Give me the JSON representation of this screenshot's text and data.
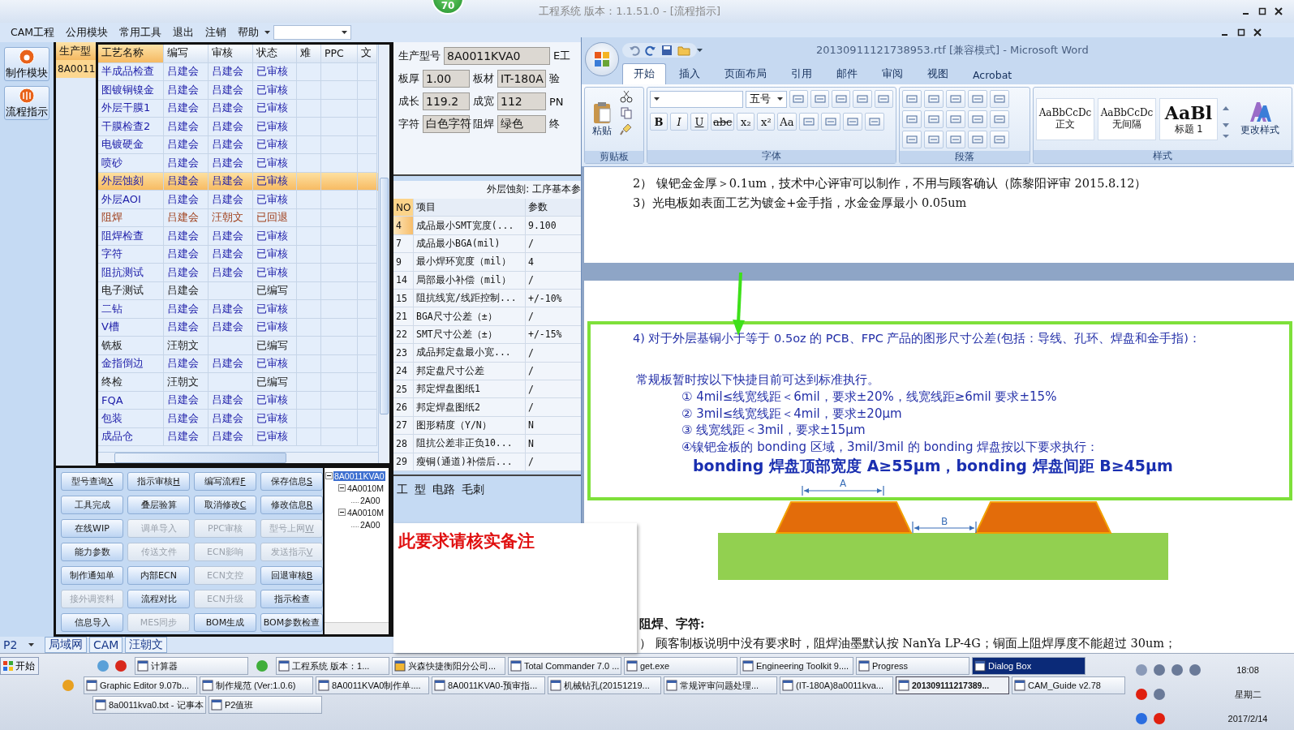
{
  "app": {
    "title": "工程系统  版本：1.1.51.0 - [流程指示]",
    "badge": "70",
    "menu": [
      "CAM工程",
      "公用模块",
      "常用工具",
      "退出",
      "注销",
      "帮助"
    ],
    "side_buttons": [
      {
        "label": "制作模块"
      },
      {
        "label": "流程指示"
      }
    ],
    "order_list": {
      "header": "生产型",
      "rows": [
        {
          "text": "8A0011",
          "selected": true
        }
      ]
    },
    "process_table": {
      "columns": [
        "工艺名称",
        "编写",
        "审核",
        "状态",
        "难",
        "PPC",
        "文"
      ],
      "rows": [
        {
          "name": "半成品检查",
          "writer": "吕建会",
          "reviewer": "吕建会",
          "status": "已审核",
          "kind": "approved",
          "selected": false
        },
        {
          "name": "图镀铜镍金",
          "writer": "吕建会",
          "reviewer": "吕建会",
          "status": "已审核",
          "kind": "approved",
          "selected": false
        },
        {
          "name": "外层干膜1",
          "writer": "吕建会",
          "reviewer": "吕建会",
          "status": "已审核",
          "kind": "approved",
          "selected": false
        },
        {
          "name": "干膜检查2",
          "writer": "吕建会",
          "reviewer": "吕建会",
          "status": "已审核",
          "kind": "approved",
          "selected": false
        },
        {
          "name": "电镀硬金",
          "writer": "吕建会",
          "reviewer": "吕建会",
          "status": "已审核",
          "kind": "approved",
          "selected": false
        },
        {
          "name": "喷砂",
          "writer": "吕建会",
          "reviewer": "吕建会",
          "status": "已审核",
          "kind": "approved",
          "selected": false
        },
        {
          "name": "外层蚀刻",
          "writer": "吕建会",
          "reviewer": "吕建会",
          "status": "已审核",
          "kind": "approved",
          "selected": true
        },
        {
          "name": "外层AOI",
          "writer": "吕建会",
          "reviewer": "吕建会",
          "status": "已审核",
          "kind": "approved",
          "selected": false
        },
        {
          "name": "阻焊",
          "writer": "吕建会",
          "reviewer": "汪朝文",
          "status": "已回退",
          "kind": "returned",
          "selected": false
        },
        {
          "name": "阻焊检查",
          "writer": "吕建会",
          "reviewer": "吕建会",
          "status": "已审核",
          "kind": "approved",
          "selected": false
        },
        {
          "name": "字符",
          "writer": "吕建会",
          "reviewer": "吕建会",
          "status": "已审核",
          "kind": "approved",
          "selected": false
        },
        {
          "name": "阻抗测试",
          "writer": "吕建会",
          "reviewer": "吕建会",
          "status": "已审核",
          "kind": "approved",
          "selected": false
        },
        {
          "name": "电子测试",
          "writer": "吕建会",
          "status": "已编写",
          "kind": "draft",
          "selected": false
        },
        {
          "name": "二钻",
          "writer": "吕建会",
          "reviewer": "吕建会",
          "status": "已审核",
          "kind": "approved",
          "selected": false
        },
        {
          "name": "V槽",
          "writer": "吕建会",
          "reviewer": "吕建会",
          "status": "已审核",
          "kind": "approved",
          "selected": false
        },
        {
          "name": "铣板",
          "writer": "汪朝文",
          "status": "已编写",
          "kind": "draft",
          "selected": false
        },
        {
          "name": "金指倒边",
          "writer": "吕建会",
          "reviewer": "吕建会",
          "status": "已审核",
          "kind": "approved",
          "selected": false
        },
        {
          "name": "终检",
          "writer": "汪朝文",
          "status": "已编写",
          "kind": "draft",
          "selected": false
        },
        {
          "name": "FQA",
          "writer": "吕建会",
          "reviewer": "吕建会",
          "status": "已审核",
          "kind": "approved",
          "selected": false
        },
        {
          "name": "包装",
          "writer": "吕建会",
          "reviewer": "吕建会",
          "status": "已审核",
          "kind": "approved",
          "selected": false
        },
        {
          "name": "成品仓",
          "writer": "吕建会",
          "reviewer": "吕建会",
          "status": "已审核",
          "kind": "approved",
          "selected": false
        }
      ]
    },
    "info_rows": [
      {
        "fields": [
          {
            "label": "生产型号",
            "value": "8A0011KVA0"
          }
        ],
        "trailing": "E工"
      },
      {
        "fields": [
          {
            "label": "板厚",
            "value": "1.00"
          },
          {
            "label": "板材",
            "value": "IT-180A"
          }
        ],
        "trailing": "验"
      },
      {
        "fields": [
          {
            "label": "成长",
            "value": "119.2"
          },
          {
            "label": "成宽",
            "value": "112"
          }
        ],
        "trailing": "PN"
      },
      {
        "fields": [
          {
            "label": "字符",
            "value": "白色字符"
          },
          {
            "label": "阻焊",
            "value": "绿色"
          }
        ],
        "trailing": "终"
      }
    ],
    "params": {
      "title": "外层蚀刻: 工序基本参",
      "columns": [
        "NO",
        "项目",
        "参数"
      ],
      "rows": [
        {
          "no": "4",
          "item": "成品最小SMT宽度(...",
          "value": "9.100",
          "selected": true
        },
        {
          "no": "7",
          "item": "成品最小BGA(mil)",
          "value": "/",
          "selected": false
        },
        {
          "no": "9",
          "item": "最小焊环宽度（mil）",
          "value": "4",
          "selected": false
        },
        {
          "no": "14",
          "item": "局部最小补偿（mil）",
          "value": "/",
          "selected": false
        },
        {
          "no": "15",
          "item": "阻抗线宽/线距控制...",
          "value": "+/-10%",
          "selected": false
        },
        {
          "no": "21",
          "item": "BGA尺寸公差（±）",
          "value": "/",
          "selected": false
        },
        {
          "no": "22",
          "item": "SMT尺寸公差（±）",
          "value": "+/-15%",
          "selected": false
        },
        {
          "no": "23",
          "item": "成品邦定盘最小宽...",
          "value": "/",
          "selected": false
        },
        {
          "no": "24",
          "item": "邦定盘尺寸公差",
          "value": "/",
          "selected": false
        },
        {
          "no": "25",
          "item": "邦定焊盘图纸1",
          "value": "/",
          "selected": false
        },
        {
          "no": "26",
          "item": "邦定焊盘图纸2",
          "value": "/",
          "selected": false
        },
        {
          "no": "27",
          "item": "图形精度（Y/N）",
          "value": "N",
          "selected": false
        },
        {
          "no": "28",
          "item": "阻抗公差非正负10...",
          "value": "N",
          "selected": false
        },
        {
          "no": "29",
          "item": "瘦铜(通道)补偿后...",
          "value": "/",
          "selected": false
        }
      ]
    },
    "buttons": [
      {
        "label": "型号查询",
        "hotkey": "X",
        "disabled": false
      },
      {
        "label": "指示审核",
        "hotkey": "H",
        "disabled": false
      },
      {
        "label": "编写流程",
        "hotkey": "F",
        "disabled": false
      },
      {
        "label": "保存信息",
        "hotkey": "S",
        "disabled": false
      },
      {
        "label": "工具完成",
        "disabled": false
      },
      {
        "label": "叠层验算",
        "disabled": false
      },
      {
        "label": "取消修改",
        "hotkey": "C",
        "disabled": false
      },
      {
        "label": "修改信息",
        "hotkey": "R",
        "disabled": false
      },
      {
        "label": "在线WIP",
        "disabled": false
      },
      {
        "label": "调单导入",
        "disabled": true
      },
      {
        "label": "PPC审核",
        "disabled": true
      },
      {
        "label": "型号上网",
        "hotkey": "W",
        "disabled": true
      },
      {
        "label": "能力参数",
        "disabled": false
      },
      {
        "label": "传送文件",
        "disabled": true
      },
      {
        "label": "ECN影响",
        "disabled": true
      },
      {
        "label": "发送指示",
        "hotkey": "V",
        "disabled": true
      },
      {
        "label": "制作通知单",
        "disabled": false
      },
      {
        "label": "内部ECN",
        "disabled": false
      },
      {
        "label": "ECN文控",
        "disabled": true
      },
      {
        "label": "回退审核",
        "hotkey": "B",
        "disabled": false
      },
      {
        "label": "接外调资料",
        "disabled": true
      },
      {
        "label": "流程对比",
        "disabled": false
      },
      {
        "label": "ECN升级",
        "disabled": true
      },
      {
        "label": "指示检查",
        "disabled": false
      },
      {
        "label": "信息导入",
        "disabled": false
      },
      {
        "label": "MES同步",
        "disabled": true
      },
      {
        "label": "BOM生成",
        "disabled": false
      },
      {
        "label": "BOM参数检查",
        "disabled": false
      }
    ],
    "tree": [
      {
        "label": "8A0011KVA0",
        "selected": true,
        "expanded": true,
        "children": [
          {
            "label": "4A0010M",
            "selected": false,
            "expanded": true,
            "children": [
              {
                "label": "2A00",
                "selected": false
              }
            ]
          },
          {
            "label": "4A0010M",
            "selected": false,
            "expanded": true,
            "children": [
              {
                "label": "2A00",
                "selected": false
              }
            ]
          }
        ]
      }
    ],
    "fragments": [
      "工",
      "型",
      "电路",
      "毛刺"
    ],
    "status_bar": {
      "dropdown": "P2",
      "tabs": [
        "局域网",
        "CAM",
        "汪朝文"
      ]
    }
  },
  "popup": {
    "text": "此要求请核实备注"
  },
  "word": {
    "title": "20130911121738953.rtf [兼容模式] - Microsoft Word",
    "tabs": [
      {
        "label": "开始",
        "selected": true
      },
      {
        "label": "插入",
        "selected": false
      },
      {
        "label": "页面布局",
        "selected": false
      },
      {
        "label": "引用",
        "selected": false
      },
      {
        "label": "邮件",
        "selected": false
      },
      {
        "label": "审阅",
        "selected": false
      },
      {
        "label": "视图",
        "selected": false
      },
      {
        "label": "Acrobat",
        "selected": false
      }
    ],
    "groups": [
      "剪贴板",
      "字体",
      "段落",
      "样式"
    ],
    "paste": "粘贴",
    "font_size": "五号",
    "font_buttons": [
      "B",
      "I",
      "U",
      "abc",
      "x₂",
      "x²",
      "Aa"
    ],
    "styles": [
      {
        "preview": "AaBbCcDc",
        "name": "正文"
      },
      {
        "preview": "AaBbCcDc",
        "name": "无间隔"
      },
      {
        "preview": "AaBl",
        "name": "标题 1",
        "kind": "heading"
      }
    ],
    "change_styles": "更改样式",
    "page1": [
      {
        "kind": "serif",
        "text": "2） 镍钯金金厚＞0.1um，技术中心评审可以制作，不用与顾客确认（陈黎阳评审 2015.8.12）"
      },
      {
        "kind": "serif",
        "text": "3）光电板如表面工艺为镀金+金手指，水金金厚最小 0.05um"
      }
    ],
    "highlighted": [
      {
        "kind": "blue",
        "text": "4) 对于外层基铜小于等于 0.5oz 的 PCB、FPC 产品的图形尺寸公差(包括：导线、孔环、焊盘和金手指)："
      },
      {
        "kind": "blue-sub",
        "text": "常规板暂时按以下快捷目前可达到标准执行。"
      },
      {
        "kind": "blue-item",
        "text": "① 4mil≤线宽线距＜6mil，要求±20%，线宽线距≥6mil 要求±15%"
      },
      {
        "kind": "blue-item",
        "text": "② 3mil≤线宽线距＜4mil，要求±20μm"
      },
      {
        "kind": "blue-item",
        "text": "③ 线宽线距＜3mil，要求±15μm"
      },
      {
        "kind": "blue-item",
        "text": "④镍钯金板的 bonding 区域，3mil/3mil 的 bonding 焊盘按以下要求执行："
      },
      {
        "kind": "bold",
        "text": "bonding 焊盘顶部宽度 A≥55μm，bonding 焊盘间距 B≥45μm"
      }
    ],
    "figure_labels": [
      "A",
      "B"
    ],
    "after": [
      {
        "kind": "heading",
        "text": "阻焊、字符:"
      },
      {
        "kind": "serif",
        "text": "） 顾客制板说明中没有要求时，阻焊油墨默认按 NanYa LP-4G；铜面上阻焊厚度不能超过 30um；"
      }
    ]
  },
  "taskbar": {
    "start": "开始",
    "rows": [
      [
        {
          "label": "计算器",
          "selected": false,
          "active": false
        },
        {
          "label": "工程系统  版本：1...",
          "selected": false,
          "active": false
        },
        {
          "label": "兴森快捷衡阳分公司...",
          "selected": false,
          "active": false
        },
        {
          "label": "Total Commander 7.0 ...",
          "selected": false,
          "active": false
        },
        {
          "label": "get.exe",
          "selected": false,
          "active": false
        },
        {
          "label": "Engineering Toolkit 9....",
          "selected": false,
          "active": false
        },
        {
          "label": "Progress",
          "selected": false,
          "active": false
        },
        {
          "label": "Dialog Box",
          "selected": true,
          "active": false
        }
      ],
      [
        {
          "label": "Graphic Editor 9.07b...",
          "selected": false,
          "active": false
        },
        {
          "label": "制作规范 (Ver:1.0.6)",
          "selected": false,
          "active": false
        },
        {
          "label": "8A0011KVA0制作单....",
          "selected": false,
          "active": false
        },
        {
          "label": "8A0011KVA0-预审指...",
          "selected": false,
          "active": false
        },
        {
          "label": "机械钻孔(20151219...",
          "selected": false,
          "active": false
        },
        {
          "label": "常规评审问题处理...",
          "selected": false,
          "active": false
        },
        {
          "label": "(IT-180A)8a0011kva...",
          "selected": false,
          "active": false
        },
        {
          "label": "201309111217389...",
          "selected": false,
          "active": true
        },
        {
          "label": "CAM_Guide v2.78",
          "selected": false,
          "active": false
        }
      ],
      [
        {
          "label": "8a0011kva0.txt - 记事本",
          "selected": false,
          "active": false
        },
        {
          "label": "P2值班",
          "selected": false,
          "active": false
        }
      ]
    ],
    "time": "18:08",
    "weekday": "星期二",
    "date": "2017/2/14"
  }
}
